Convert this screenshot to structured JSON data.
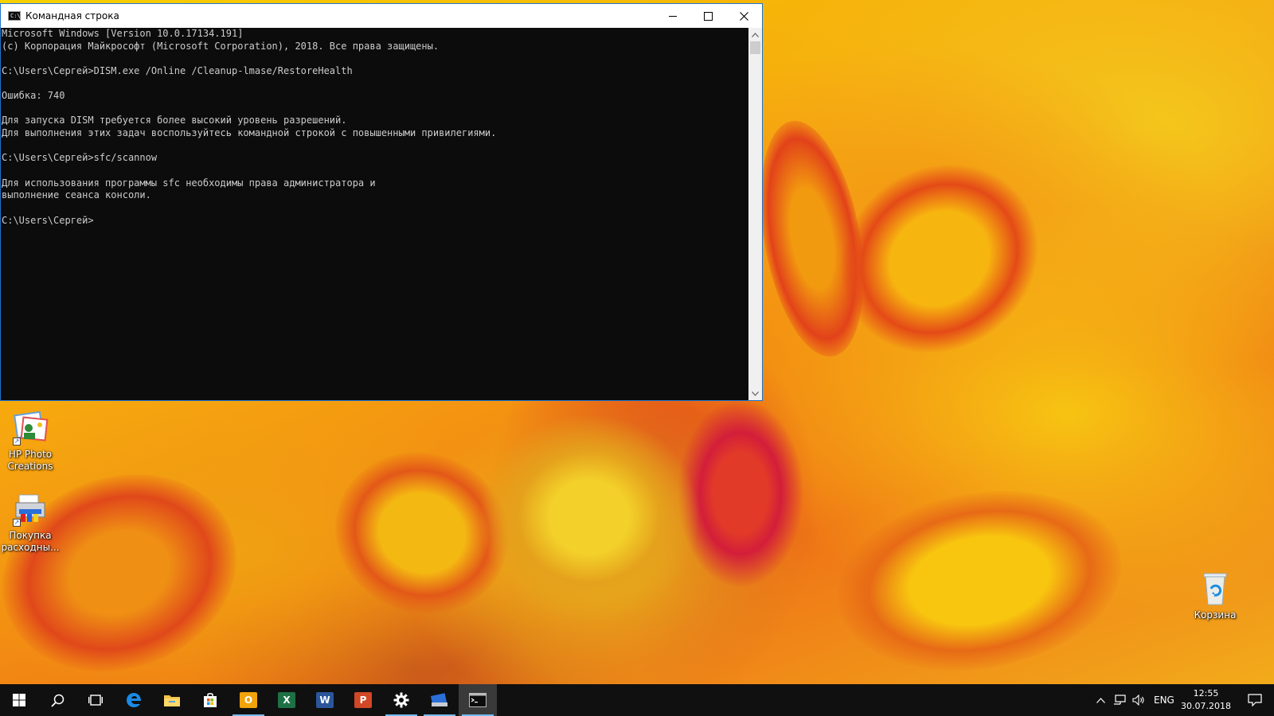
{
  "window": {
    "title": "Командная строка",
    "icon": "C:\\",
    "controls": {
      "minimize": "minimize-icon",
      "maximize": "maximize-icon",
      "close": "close-icon"
    }
  },
  "console": {
    "lines": [
      "Microsoft Windows [Version 10.0.17134.191]",
      "(с) Корпорация Майкрософт (Microsoft Corporation), 2018. Все права защищены.",
      "",
      "C:\\Users\\Сергей>DISM.exe /Online /Cleanup-lmase/RestoreHealth",
      "",
      "Ошибка: 740",
      "",
      "Для запуска DISM требуется более высокий уровень разрешений.",
      "Для выполнения этих задач воспользуйтесь командной строкой с повышенными привилегиями.",
      "",
      "C:\\Users\\Сергей>sfc/scannow",
      "",
      "Для использования программы sfc необходимы права администратора и",
      "выполнение сеанса консоли.",
      "",
      "C:\\Users\\Сергей>"
    ]
  },
  "desktop": {
    "icons": [
      {
        "label_line1": "HP Photo",
        "label_line2": "Creations"
      },
      {
        "label_line1": "Покупка",
        "label_line2": "расходны..."
      },
      {
        "label_line1": "Корзина"
      }
    ]
  },
  "taskbar": {
    "apps": [
      "start",
      "search",
      "task-view",
      "edge",
      "file-explorer",
      "store",
      "outlook",
      "excel",
      "word",
      "powerpoint",
      "settings",
      "hp-app",
      "command-prompt"
    ],
    "outlook_letter": "O",
    "excel_letter": "X",
    "word_letter": "W",
    "powerpoint_letter": "P",
    "language": "ENG",
    "time": "12:55",
    "date": "30.07.2018"
  },
  "colors": {
    "console_bg": "#0c0c0c",
    "console_text": "#cccccc",
    "taskbar_bg": "#101010",
    "accent": "#76b9ed"
  }
}
